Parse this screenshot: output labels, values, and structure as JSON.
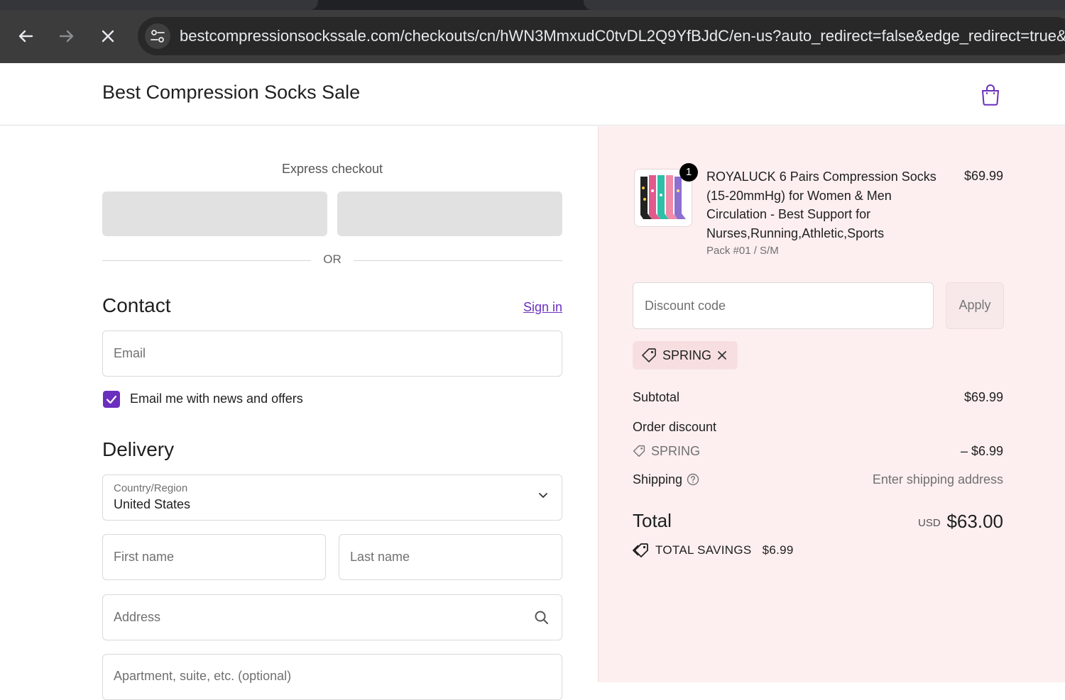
{
  "browser": {
    "url": "bestcompressionsockssale.com/checkouts/cn/hWN3MmxudC0tvDL2Q9YfBJdC/en-us?auto_redirect=false&edge_redirect=true&"
  },
  "store": {
    "title": "Best Compression Socks Sale"
  },
  "checkout": {
    "express_label": "Express checkout",
    "or_label": "OR",
    "contact": {
      "heading": "Contact",
      "sign_in": "Sign in",
      "email_placeholder": "Email",
      "news_opt_in_label": "Email me with news and offers",
      "news_opt_in_checked": true
    },
    "delivery": {
      "heading": "Delivery",
      "country_label": "Country/Region",
      "country_value": "United States",
      "first_name_placeholder": "First name",
      "last_name_placeholder": "Last name",
      "address_placeholder": "Address",
      "apartment_placeholder": "Apartment, suite, etc. (optional)"
    }
  },
  "summary": {
    "product": {
      "quantity": "1",
      "name": "ROYALUCK 6 Pairs Compression Socks (15-20mmHg) for Women & Men Circulation - Best Support for Nurses,Running,Athletic,Sports",
      "variant": "Pack #01 / S/M",
      "price": "$69.99"
    },
    "discount_placeholder": "Discount code",
    "apply_label": "Apply",
    "applied_code": "SPRING",
    "subtotal_label": "Subtotal",
    "subtotal_value": "$69.99",
    "order_discount_label": "Order discount",
    "order_discount_code": "SPRING",
    "order_discount_value": "– $6.99",
    "shipping_label": "Shipping",
    "shipping_value": "Enter shipping address",
    "total_label": "Total",
    "total_currency": "USD",
    "total_value": "$63.00",
    "total_savings_label": "TOTAL SAVINGS",
    "total_savings_value": "$6.99"
  },
  "colors": {
    "accent": "#6b2fbf",
    "summary_bg": "#fdeff0",
    "chrome_bg": "#3c3c3c"
  }
}
